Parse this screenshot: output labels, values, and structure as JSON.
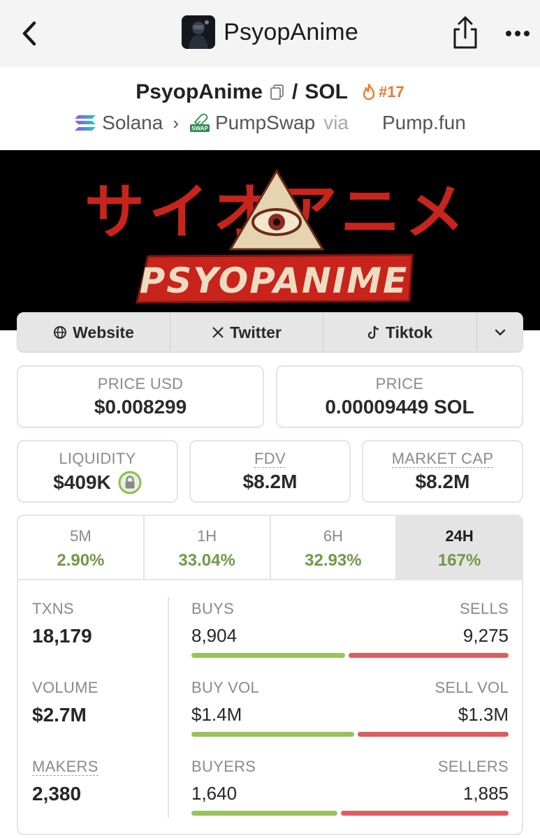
{
  "nav": {
    "title": "PsyopAnime"
  },
  "pair": {
    "base": "PsyopAnime",
    "separator": "/",
    "quote": "SOL",
    "rank": "#17"
  },
  "chain": {
    "network": "Solana",
    "dex": "PumpSwap",
    "via_label": "via",
    "launchpad": "Pump.fun",
    "dex_badge": "SWAP"
  },
  "banner": {
    "jp_text": "サイオアニメ",
    "logo_text": "PSYOPANIME"
  },
  "links": {
    "website": "Website",
    "twitter": "Twitter",
    "tiktok": "Tiktok"
  },
  "prices": {
    "price_usd_label": "PRICE USD",
    "price_usd": "$0.008299",
    "price_label": "PRICE",
    "price_native": "0.00009449 SOL"
  },
  "metrics": {
    "liquidity_label": "LIQUIDITY",
    "liquidity": "$409K",
    "fdv_label": "FDV",
    "fdv": "$8.2M",
    "mcap_label": "MARKET CAP",
    "mcap": "$8.2M"
  },
  "timeframes": [
    {
      "label": "5M",
      "change": "2.90%"
    },
    {
      "label": "1H",
      "change": "33.04%"
    },
    {
      "label": "6H",
      "change": "32.93%"
    },
    {
      "label": "24H",
      "change": "167%",
      "active": true
    }
  ],
  "stats": {
    "txns_label": "TXNS",
    "txns": "18,179",
    "volume_label": "VOLUME",
    "volume": "$2.7M",
    "makers_label": "MAKERS",
    "makers": "2,380"
  },
  "ratios": [
    {
      "left_label": "BUYS",
      "left": "8,904",
      "right_label": "SELLS",
      "right": "9,275",
      "left_share": 0.49
    },
    {
      "left_label": "BUY VOL",
      "left": "$1.4M",
      "right_label": "SELL VOL",
      "right": "$1.3M",
      "left_share": 0.52
    },
    {
      "left_label": "BUYERS",
      "left": "1,640",
      "right_label": "SELLERS",
      "right": "1,885",
      "left_share": 0.465
    }
  ],
  "colors": {
    "positive": "#6f9a48",
    "buy_bar": "#99c25c",
    "sell_bar": "#df5c5c",
    "rank": "#f0782a",
    "banner_red": "#c8241c"
  }
}
